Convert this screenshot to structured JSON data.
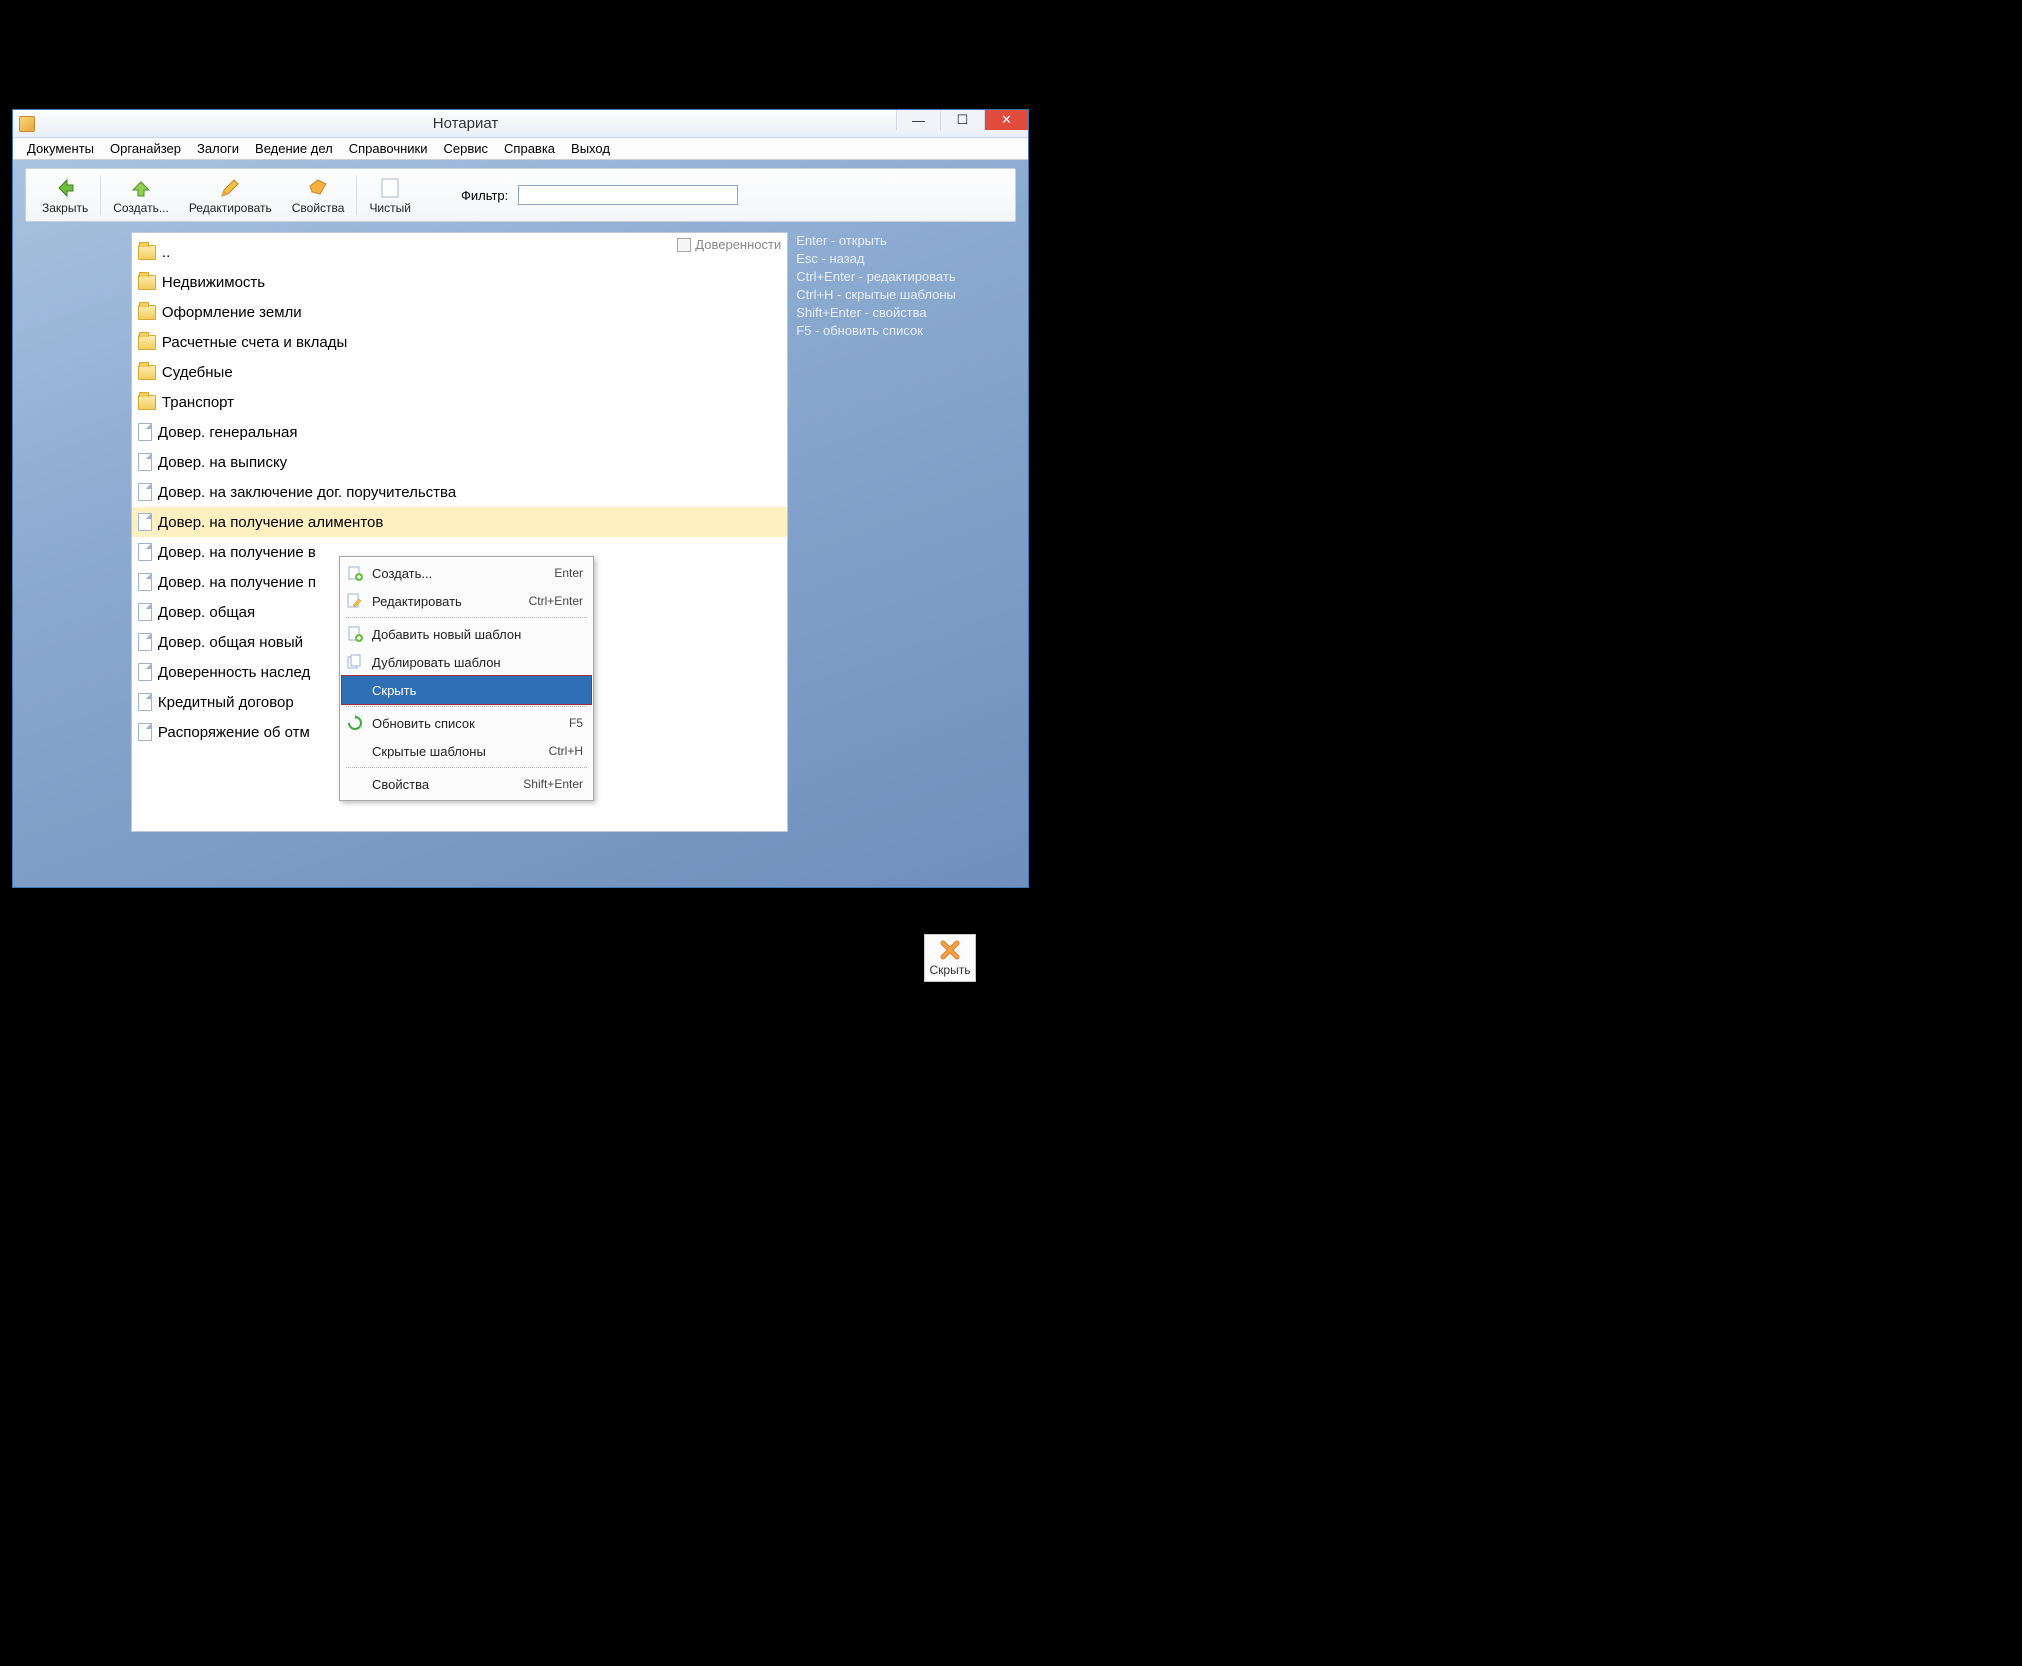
{
  "window": {
    "title": "Нотариат"
  },
  "menubar": [
    "Документы",
    "Органайзер",
    "Залоги",
    "Ведение дел",
    "Справочники",
    "Сервис",
    "Справка",
    "Выход"
  ],
  "toolbar": {
    "close": "Закрыть",
    "create": "Создать...",
    "edit": "Редактировать",
    "props": "Свойства",
    "clean": "Чистый",
    "filter_label": "Фильтр:",
    "filter_value": ""
  },
  "list_header": "Доверенности",
  "items": [
    {
      "type": "up",
      "label": ".."
    },
    {
      "type": "folder",
      "label": "Недвижимость"
    },
    {
      "type": "folder",
      "label": "Оформление земли"
    },
    {
      "type": "folder",
      "label": "Расчетные счета и вклады"
    },
    {
      "type": "folder",
      "label": "Судебные"
    },
    {
      "type": "folder",
      "label": "Транспорт"
    },
    {
      "type": "doc",
      "label": "Довер. генеральная"
    },
    {
      "type": "doc",
      "label": "Довер. на выписку"
    },
    {
      "type": "doc",
      "label": "Довер. на заключение дог. поручительства"
    },
    {
      "type": "doc",
      "label": "Довер. на получение алиментов",
      "selected": true
    },
    {
      "type": "doc",
      "label": "Довер. на получение в"
    },
    {
      "type": "doc",
      "label": "Довер. на получение п"
    },
    {
      "type": "doc",
      "label": "Довер. общая"
    },
    {
      "type": "doc",
      "label": "Довер. общая новый"
    },
    {
      "type": "doc",
      "label": "Доверенность наслед"
    },
    {
      "type": "doc",
      "label": "Кредитный договор"
    },
    {
      "type": "doc",
      "label": "Распоряжение об отм"
    }
  ],
  "help": [
    "Enter - открыть",
    "Esc - назад",
    "Ctrl+Enter - редактировать",
    "Ctrl+H - скрытые шаблоны",
    "Shift+Enter - свойства",
    "F5 - обновить список"
  ],
  "context_menu": [
    {
      "label": "Создать...",
      "shortcut": "Enter",
      "icon": "plus"
    },
    {
      "label": "Редактировать",
      "shortcut": "Ctrl+Enter",
      "icon": "pencil"
    },
    {
      "sep": true
    },
    {
      "label": "Добавить новый шаблон",
      "icon": "add-page"
    },
    {
      "label": "Дублировать шаблон",
      "icon": "dup-page"
    },
    {
      "label": "Скрыть",
      "highlighted": true
    },
    {
      "sep": true
    },
    {
      "label": "Обновить список",
      "shortcut": "F5",
      "icon": "refresh"
    },
    {
      "label": "Скрытые шаблоны",
      "shortcut": "Ctrl+H"
    },
    {
      "sep": true
    },
    {
      "label": "Свойства",
      "shortcut": "Shift+Enter"
    }
  ],
  "float_button": "Скрыть"
}
